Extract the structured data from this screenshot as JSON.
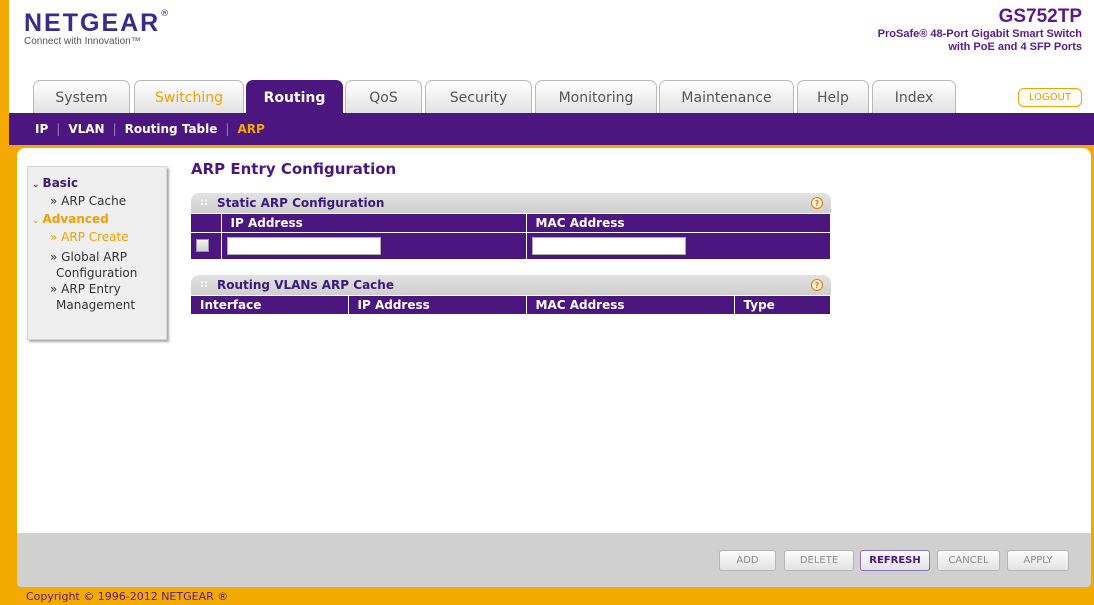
{
  "header": {
    "logo_word": "NETGEAR",
    "logo_reg": "®",
    "logo_tagline": "Connect with Innovation™",
    "model": "GS752TP",
    "desc_line1": "ProSafe® 48-Port Gigabit Smart Switch",
    "desc_line2": "with PoE and 4 SFP Ports"
  },
  "tabs": [
    {
      "label": "System"
    },
    {
      "label": "Switching"
    },
    {
      "label": "Routing"
    },
    {
      "label": "QoS"
    },
    {
      "label": "Security"
    },
    {
      "label": "Monitoring"
    },
    {
      "label": "Maintenance"
    },
    {
      "label": "Help"
    },
    {
      "label": "Index"
    }
  ],
  "logout_label": "LOGOUT",
  "subnav": [
    "IP",
    "VLAN",
    "Routing Table",
    "ARP"
  ],
  "leftnav": {
    "basic": "Basic",
    "arp_cache": "» ARP Cache",
    "advanced": "Advanced",
    "arp_create": "» ARP Create",
    "global_arp_1": "» Global ARP",
    "global_arp_2": "Configuration",
    "arp_entry_1": "» ARP Entry",
    "arp_entry_2": "Management"
  },
  "main": {
    "title": "ARP Entry Configuration",
    "static_panel": {
      "title": "Static ARP Configuration",
      "col_ip": "IP Address",
      "col_mac": "MAC Address",
      "ip_value": "",
      "mac_value": ""
    },
    "cache_panel": {
      "title": "Routing VLANs ARP Cache",
      "col_interface": "Interface",
      "col_ip": "IP Address",
      "col_mac": "MAC Address",
      "col_type": "Type"
    },
    "help_glyph": "?"
  },
  "buttons": {
    "add": "ADD",
    "delete": "DELETE",
    "refresh": "REFRESH",
    "cancel": "CANCEL",
    "apply": "APPLY"
  },
  "copyright": "Copyright © 1996-2012 NETGEAR ®",
  "colors": {
    "purple": "#4b1680",
    "orange": "#f3a900"
  }
}
